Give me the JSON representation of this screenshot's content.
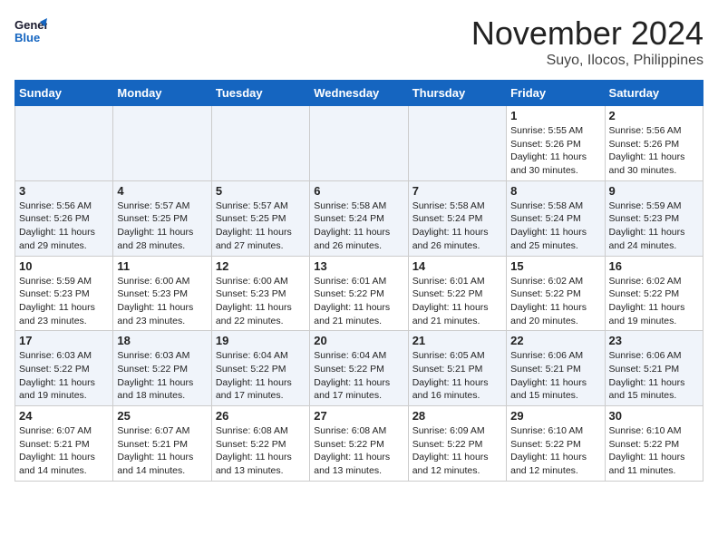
{
  "header": {
    "logo_line1": "General",
    "logo_line2": "Blue",
    "month": "November 2024",
    "location": "Suyo, Ilocos, Philippines"
  },
  "weekdays": [
    "Sunday",
    "Monday",
    "Tuesday",
    "Wednesday",
    "Thursday",
    "Friday",
    "Saturday"
  ],
  "weeks": [
    [
      {
        "day": "",
        "info": ""
      },
      {
        "day": "",
        "info": ""
      },
      {
        "day": "",
        "info": ""
      },
      {
        "day": "",
        "info": ""
      },
      {
        "day": "",
        "info": ""
      },
      {
        "day": "1",
        "info": "Sunrise: 5:55 AM\nSunset: 5:26 PM\nDaylight: 11 hours and 30 minutes."
      },
      {
        "day": "2",
        "info": "Sunrise: 5:56 AM\nSunset: 5:26 PM\nDaylight: 11 hours and 30 minutes."
      }
    ],
    [
      {
        "day": "3",
        "info": "Sunrise: 5:56 AM\nSunset: 5:26 PM\nDaylight: 11 hours and 29 minutes."
      },
      {
        "day": "4",
        "info": "Sunrise: 5:57 AM\nSunset: 5:25 PM\nDaylight: 11 hours and 28 minutes."
      },
      {
        "day": "5",
        "info": "Sunrise: 5:57 AM\nSunset: 5:25 PM\nDaylight: 11 hours and 27 minutes."
      },
      {
        "day": "6",
        "info": "Sunrise: 5:58 AM\nSunset: 5:24 PM\nDaylight: 11 hours and 26 minutes."
      },
      {
        "day": "7",
        "info": "Sunrise: 5:58 AM\nSunset: 5:24 PM\nDaylight: 11 hours and 26 minutes."
      },
      {
        "day": "8",
        "info": "Sunrise: 5:58 AM\nSunset: 5:24 PM\nDaylight: 11 hours and 25 minutes."
      },
      {
        "day": "9",
        "info": "Sunrise: 5:59 AM\nSunset: 5:23 PM\nDaylight: 11 hours and 24 minutes."
      }
    ],
    [
      {
        "day": "10",
        "info": "Sunrise: 5:59 AM\nSunset: 5:23 PM\nDaylight: 11 hours and 23 minutes."
      },
      {
        "day": "11",
        "info": "Sunrise: 6:00 AM\nSunset: 5:23 PM\nDaylight: 11 hours and 23 minutes."
      },
      {
        "day": "12",
        "info": "Sunrise: 6:00 AM\nSunset: 5:23 PM\nDaylight: 11 hours and 22 minutes."
      },
      {
        "day": "13",
        "info": "Sunrise: 6:01 AM\nSunset: 5:22 PM\nDaylight: 11 hours and 21 minutes."
      },
      {
        "day": "14",
        "info": "Sunrise: 6:01 AM\nSunset: 5:22 PM\nDaylight: 11 hours and 21 minutes."
      },
      {
        "day": "15",
        "info": "Sunrise: 6:02 AM\nSunset: 5:22 PM\nDaylight: 11 hours and 20 minutes."
      },
      {
        "day": "16",
        "info": "Sunrise: 6:02 AM\nSunset: 5:22 PM\nDaylight: 11 hours and 19 minutes."
      }
    ],
    [
      {
        "day": "17",
        "info": "Sunrise: 6:03 AM\nSunset: 5:22 PM\nDaylight: 11 hours and 19 minutes."
      },
      {
        "day": "18",
        "info": "Sunrise: 6:03 AM\nSunset: 5:22 PM\nDaylight: 11 hours and 18 minutes."
      },
      {
        "day": "19",
        "info": "Sunrise: 6:04 AM\nSunset: 5:22 PM\nDaylight: 11 hours and 17 minutes."
      },
      {
        "day": "20",
        "info": "Sunrise: 6:04 AM\nSunset: 5:22 PM\nDaylight: 11 hours and 17 minutes."
      },
      {
        "day": "21",
        "info": "Sunrise: 6:05 AM\nSunset: 5:21 PM\nDaylight: 11 hours and 16 minutes."
      },
      {
        "day": "22",
        "info": "Sunrise: 6:06 AM\nSunset: 5:21 PM\nDaylight: 11 hours and 15 minutes."
      },
      {
        "day": "23",
        "info": "Sunrise: 6:06 AM\nSunset: 5:21 PM\nDaylight: 11 hours and 15 minutes."
      }
    ],
    [
      {
        "day": "24",
        "info": "Sunrise: 6:07 AM\nSunset: 5:21 PM\nDaylight: 11 hours and 14 minutes."
      },
      {
        "day": "25",
        "info": "Sunrise: 6:07 AM\nSunset: 5:21 PM\nDaylight: 11 hours and 14 minutes."
      },
      {
        "day": "26",
        "info": "Sunrise: 6:08 AM\nSunset: 5:22 PM\nDaylight: 11 hours and 13 minutes."
      },
      {
        "day": "27",
        "info": "Sunrise: 6:08 AM\nSunset: 5:22 PM\nDaylight: 11 hours and 13 minutes."
      },
      {
        "day": "28",
        "info": "Sunrise: 6:09 AM\nSunset: 5:22 PM\nDaylight: 11 hours and 12 minutes."
      },
      {
        "day": "29",
        "info": "Sunrise: 6:10 AM\nSunset: 5:22 PM\nDaylight: 11 hours and 12 minutes."
      },
      {
        "day": "30",
        "info": "Sunrise: 6:10 AM\nSunset: 5:22 PM\nDaylight: 11 hours and 11 minutes."
      }
    ]
  ]
}
